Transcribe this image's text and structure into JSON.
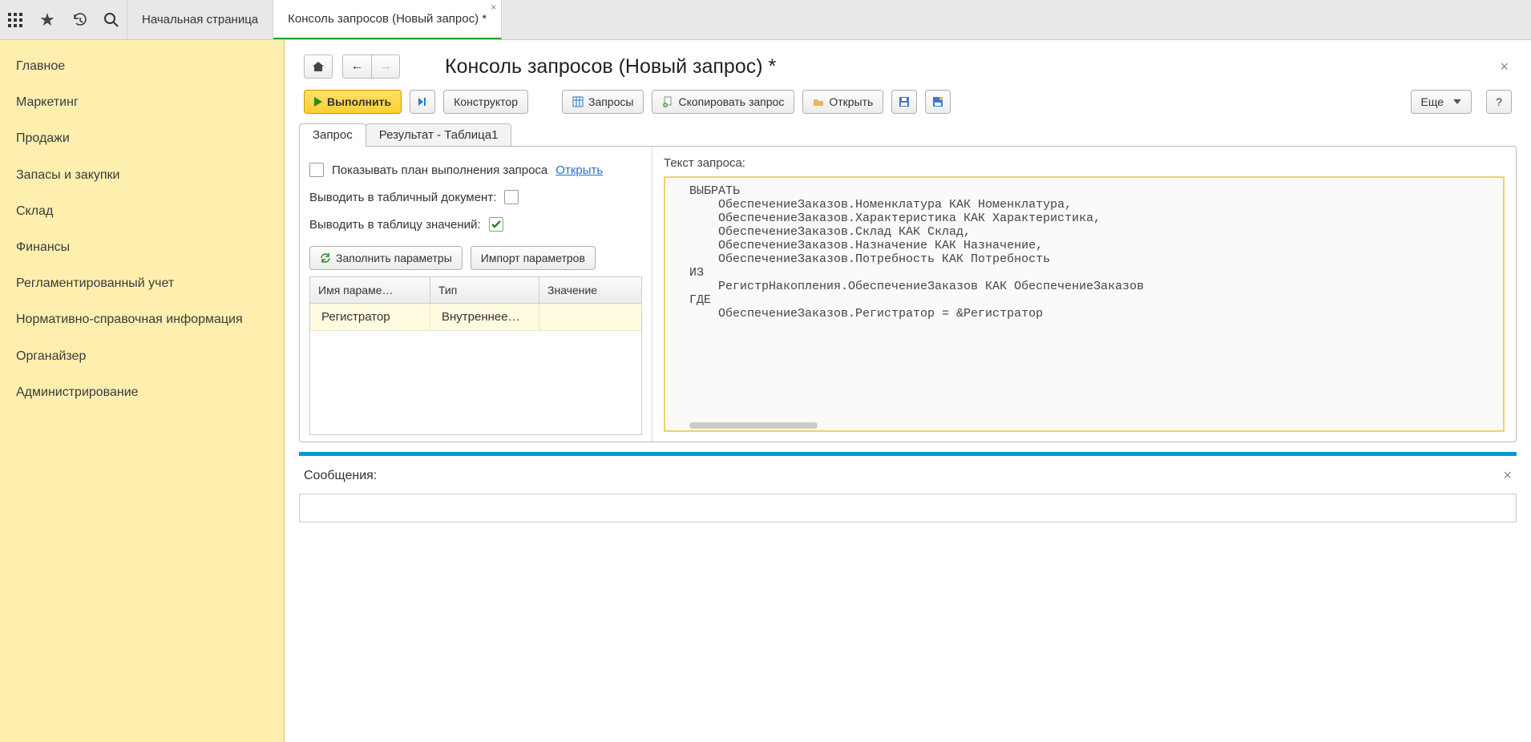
{
  "topTabs": [
    {
      "label": "Начальная страница",
      "active": false
    },
    {
      "label": "Консоль запросов (Новый запрос) *",
      "active": true
    }
  ],
  "sidebar": {
    "items": [
      "Главное",
      "Маркетинг",
      "Продажи",
      "Запасы и закупки",
      "Склад",
      "Финансы",
      "Регламентированный учет",
      "Нормативно-справочная информация",
      "Органайзер",
      "Администрирование"
    ]
  },
  "pageTitle": "Консоль запросов (Новый запрос) *",
  "toolbar": {
    "execute": "Выполнить",
    "constructor": "Конструктор",
    "queries": "Запросы",
    "copyQuery": "Скопировать запрос",
    "open": "Открыть",
    "more": "Еще",
    "help": "?"
  },
  "subtabs": {
    "query": "Запрос",
    "result": "Результат - Таблица1"
  },
  "options": {
    "showPlanLabel": "Показывать план выполнения запроса",
    "openLink": "Открыть",
    "outputDocLabel": "Выводить в табличный документ:",
    "outputTableLabel": "Выводить в таблицу значений:",
    "fillParamsBtn": "Заполнить параметры",
    "importParamsBtn": "Импорт параметров",
    "outputDocChecked": false,
    "outputTableChecked": true
  },
  "paramTable": {
    "headers": {
      "name": "Имя параме…",
      "type": "Тип",
      "value": "Значение"
    },
    "rows": [
      {
        "name": "Регистратор",
        "type": "Внутреннее…",
        "value": ""
      }
    ]
  },
  "queryText": {
    "label": "Текст запроса:",
    "body": "ВЫБРАТЬ\n    ОбеспечениеЗаказов.Номенклатура КАК Номенклатура,\n    ОбеспечениеЗаказов.Характеристика КАК Характеристика,\n    ОбеспечениеЗаказов.Склад КАК Склад,\n    ОбеспечениеЗаказов.Назначение КАК Назначение,\n    ОбеспечениеЗаказов.Потребность КАК Потребность\nИЗ\n    РегистрНакопления.ОбеспечениеЗаказов КАК ОбеспечениеЗаказов\nГДЕ\n    ОбеспечениеЗаказов.Регистратор = &Регистратор"
  },
  "messages": {
    "label": "Сообщения:"
  }
}
